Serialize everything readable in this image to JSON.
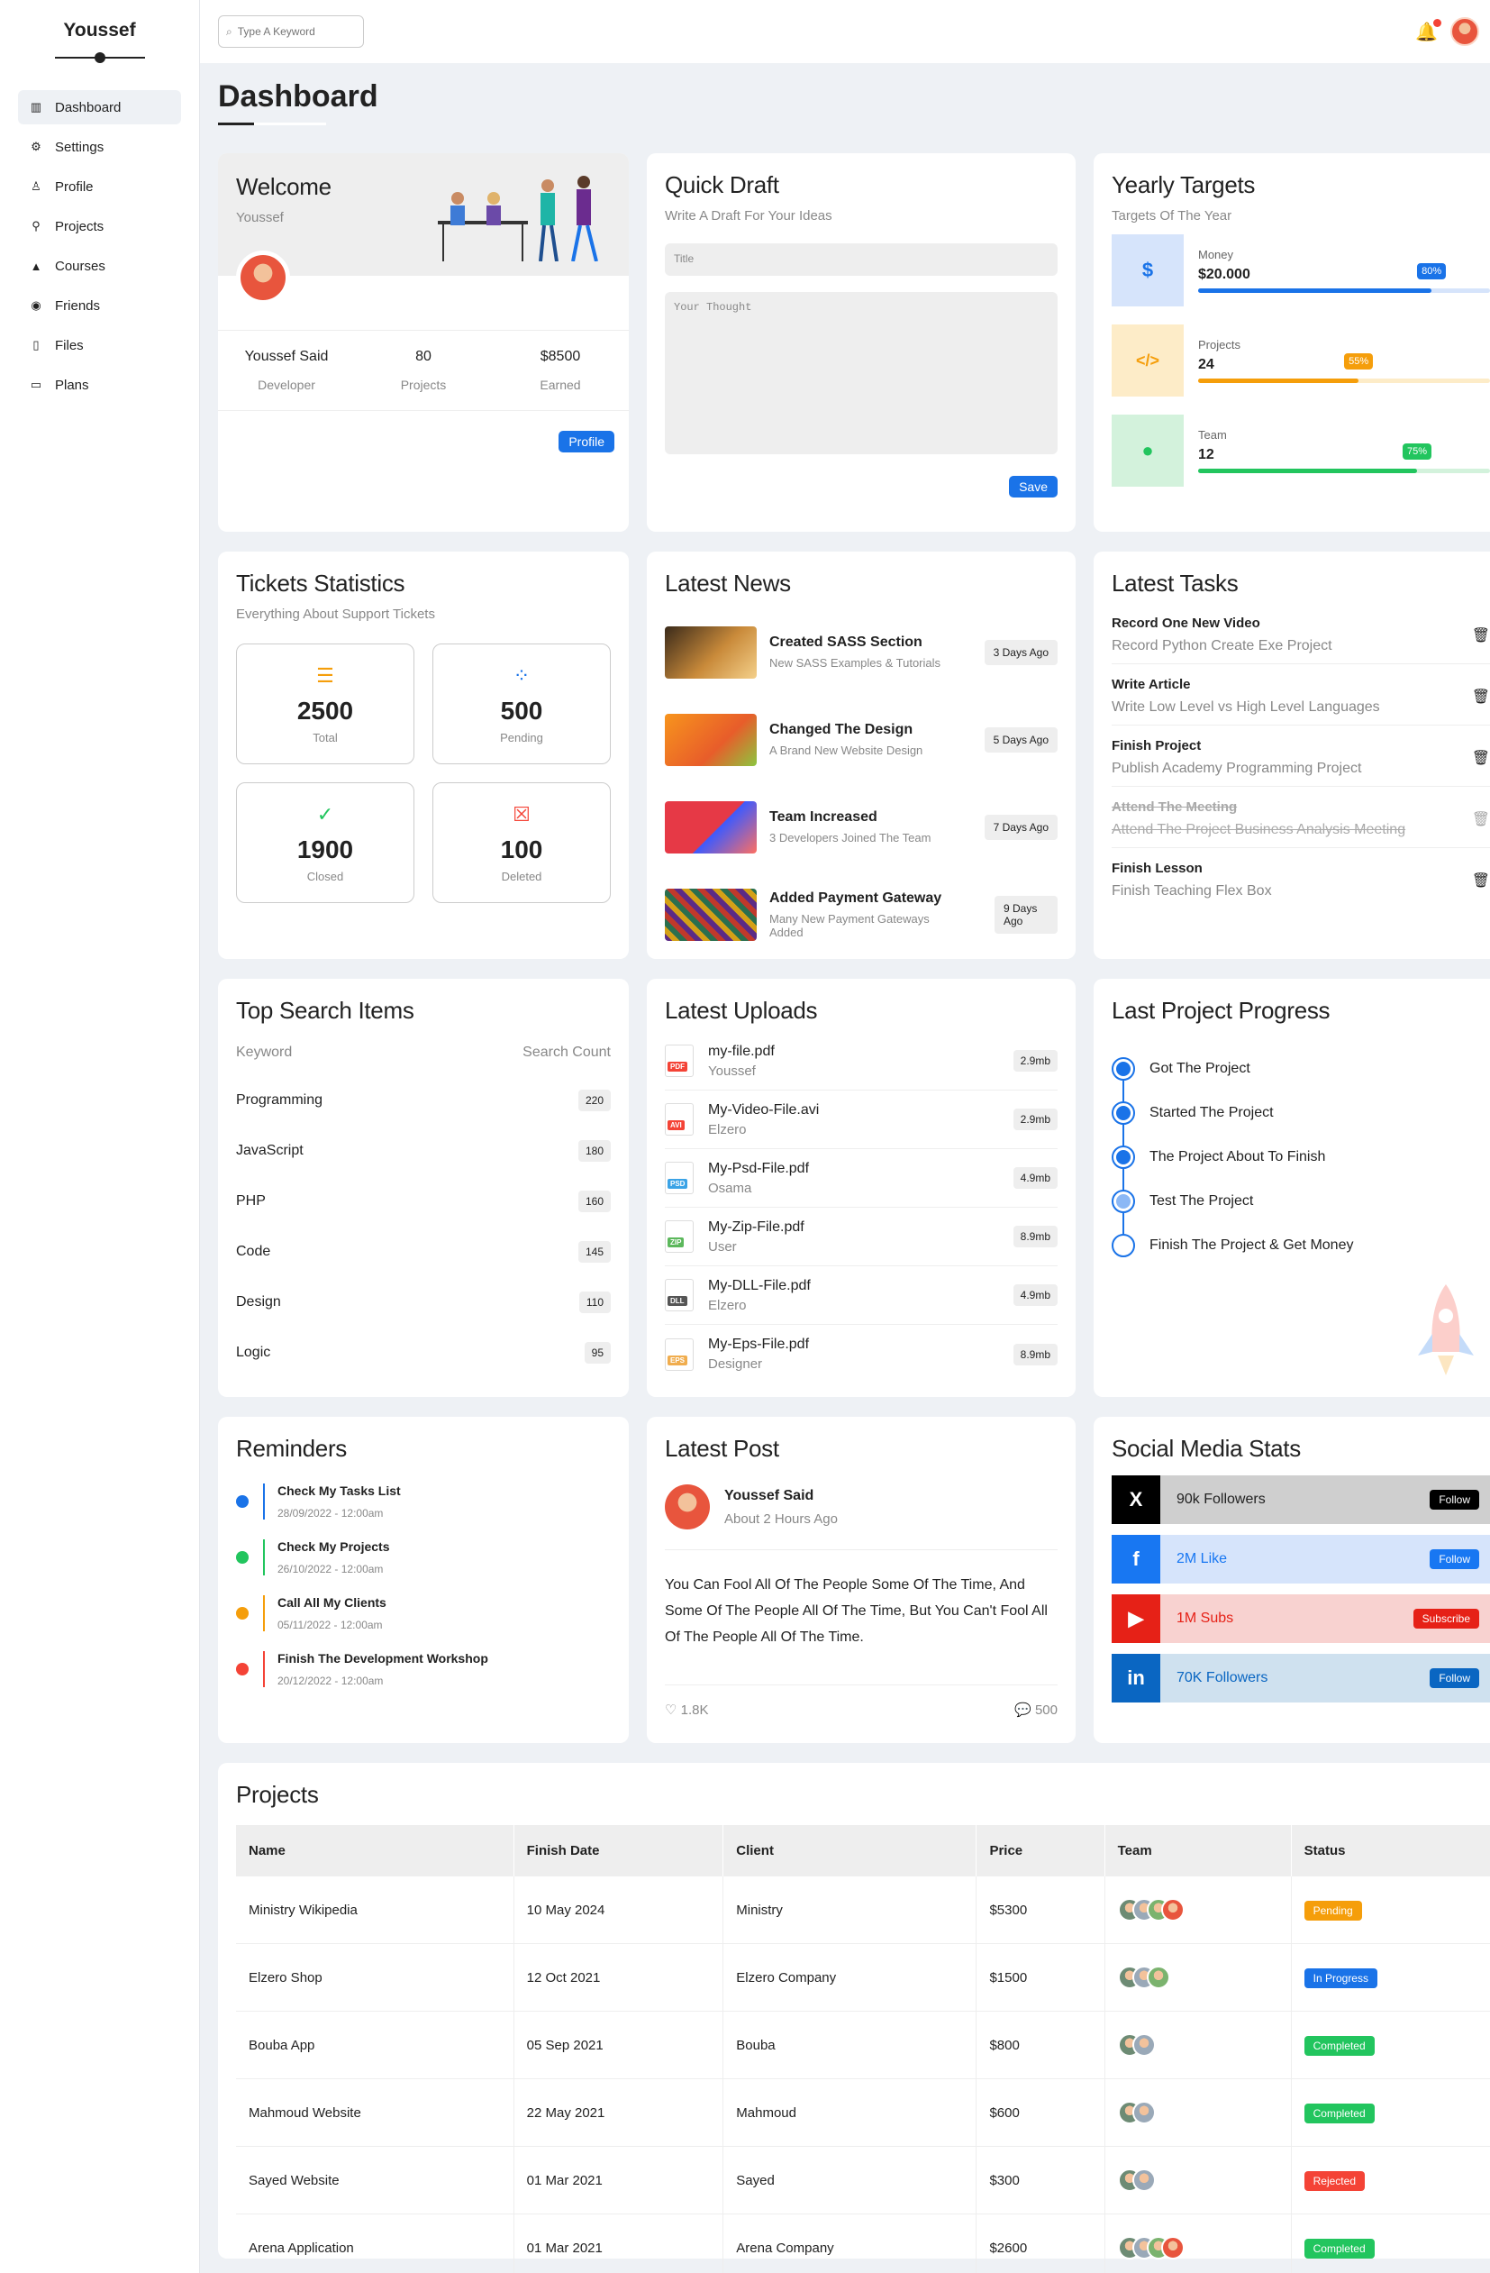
{
  "sidebar": {
    "brand": "Youssef",
    "items": [
      {
        "label": "Dashboard",
        "icon": "chart-icon"
      },
      {
        "label": "Settings",
        "icon": "gear-icon"
      },
      {
        "label": "Profile",
        "icon": "user-icon"
      },
      {
        "label": "Projects",
        "icon": "projects-icon"
      },
      {
        "label": "Courses",
        "icon": "graduation-cap-icon"
      },
      {
        "label": "Friends",
        "icon": "friends-icon"
      },
      {
        "label": "Files",
        "icon": "file-icon"
      },
      {
        "label": "Plans",
        "icon": "credit-card-icon"
      }
    ]
  },
  "header": {
    "search_placeholder": "Type A Keyword"
  },
  "page_title": "Dashboard",
  "welcome": {
    "title": "Welcome",
    "name": "Youssef",
    "stats": [
      {
        "value": "Youssef Said",
        "label": "Developer"
      },
      {
        "value": "80",
        "label": "Projects"
      },
      {
        "value": "$8500",
        "label": "Earned"
      }
    ],
    "button": "Profile"
  },
  "quick_draft": {
    "title": "Quick Draft",
    "subtitle": "Write A Draft For Your Ideas",
    "title_placeholder": "Title",
    "thought_placeholder": "Your Thought",
    "button": "Save"
  },
  "targets": {
    "title": "Yearly Targets",
    "subtitle": "Targets Of The Year",
    "items": [
      {
        "label": "Money",
        "value": "$20.000",
        "progress": 0.8,
        "pct_label": "80%",
        "color": "#1a73e8",
        "bg": "#d6e4fb",
        "icon": "$"
      },
      {
        "label": "Projects",
        "value": "24",
        "progress": 0.55,
        "pct_label": "55%",
        "color": "#f59e0b",
        "bg": "#fdecc8",
        "icon": "</>"
      },
      {
        "label": "Team",
        "value": "12",
        "progress": 0.75,
        "pct_label": "75%",
        "color": "#22c55e",
        "bg": "#d3f2dc",
        "icon": "person"
      }
    ]
  },
  "tickets": {
    "title": "Tickets Statistics",
    "subtitle": "Everything About Support Tickets",
    "items": [
      {
        "value": "2500",
        "label": "Total",
        "color": "#f59e0b"
      },
      {
        "value": "500",
        "label": "Pending",
        "color": "#1a73e8"
      },
      {
        "value": "1900",
        "label": "Closed",
        "color": "#22c55e"
      },
      {
        "value": "100",
        "label": "Deleted",
        "color": "#f44336"
      }
    ]
  },
  "news": {
    "title": "Latest News",
    "items": [
      {
        "title": "Created SASS Section",
        "desc": "New SASS Examples & Tutorials",
        "time": "3 Days Ago"
      },
      {
        "title": "Changed The Design",
        "desc": "A Brand New Website Design",
        "time": "5 Days Ago"
      },
      {
        "title": "Team Increased",
        "desc": "3 Developers Joined The Team",
        "time": "7 Days Ago"
      },
      {
        "title": "Added Payment Gateway",
        "desc": "Many New Payment Gateways Added",
        "time": "9 Days Ago"
      }
    ]
  },
  "tasks": {
    "title": "Latest Tasks",
    "items": [
      {
        "title": "Record One New Video",
        "desc": "Record Python Create Exe Project",
        "done": false
      },
      {
        "title": "Write Article",
        "desc": "Write Low Level vs High Level Languages",
        "done": false
      },
      {
        "title": "Finish Project",
        "desc": "Publish Academy Programming Project",
        "done": false
      },
      {
        "title": "Attend The Meeting",
        "desc": "Attend The Project Business Analysis Meeting",
        "done": true
      },
      {
        "title": "Finish Lesson",
        "desc": "Finish Teaching Flex Box",
        "done": false
      }
    ]
  },
  "search_items": {
    "title": "Top Search Items",
    "col_keyword": "Keyword",
    "col_count": "Search Count",
    "rows": [
      {
        "keyword": "Programming",
        "count": "220"
      },
      {
        "keyword": "JavaScript",
        "count": "180"
      },
      {
        "keyword": "PHP",
        "count": "160"
      },
      {
        "keyword": "Code",
        "count": "145"
      },
      {
        "keyword": "Design",
        "count": "110"
      },
      {
        "keyword": "Logic",
        "count": "95"
      }
    ]
  },
  "uploads": {
    "title": "Latest Uploads",
    "items": [
      {
        "name": "my-file.pdf",
        "user": "Youssef",
        "size": "2.9mb",
        "ext": "PDF",
        "color": "#f44336"
      },
      {
        "name": "My-Video-File.avi",
        "user": "Elzero",
        "size": "2.9mb",
        "ext": "AVI",
        "color": "#f44336"
      },
      {
        "name": "My-Psd-File.pdf",
        "user": "Osama",
        "size": "4.9mb",
        "ext": "PSD",
        "color": "#3ba3e6"
      },
      {
        "name": "My-Zip-File.pdf",
        "user": "User",
        "size": "8.9mb",
        "ext": "ZIP",
        "color": "#5cb85c"
      },
      {
        "name": "My-DLL-File.pdf",
        "user": "Elzero",
        "size": "4.9mb",
        "ext": "DLL",
        "color": "#555"
      },
      {
        "name": "My-Eps-File.pdf",
        "user": "Designer",
        "size": "8.9mb",
        "ext": "EPS",
        "color": "#f0ad4e"
      }
    ]
  },
  "project_progress": {
    "title": "Last Project Progress",
    "steps": [
      {
        "label": "Got The Project",
        "state": "done"
      },
      {
        "label": "Started The Project",
        "state": "done"
      },
      {
        "label": "The Project About To Finish",
        "state": "done"
      },
      {
        "label": "Test The Project",
        "state": "current"
      },
      {
        "label": "Finish The Project & Get Money",
        "state": "todo"
      }
    ]
  },
  "reminders": {
    "title": "Reminders",
    "items": [
      {
        "title": "Check My Tasks List",
        "date": "28/09/2022 - 12:00am",
        "color": "#1a73e8"
      },
      {
        "title": "Check My Projects",
        "date": "26/10/2022 - 12:00am",
        "color": "#22c55e"
      },
      {
        "title": "Call All My Clients",
        "date": "05/11/2022 - 12:00am",
        "color": "#f59e0b"
      },
      {
        "title": "Finish The Development Workshop",
        "date": "20/12/2022 - 12:00am",
        "color": "#f44336"
      }
    ]
  },
  "post": {
    "title": "Latest Post",
    "author": "Youssef Said",
    "time": "About 2 Hours Ago",
    "body": "You Can Fool All Of The People Some Of The Time, And Some Of The People All Of The Time, But You Can't Fool All Of The People All Of The Time.",
    "likes": "1.8K",
    "comments": "500"
  },
  "social": {
    "title": "Social Media Stats",
    "items": [
      {
        "text": "90k Followers",
        "button": "Follow",
        "icon": "X",
        "icon_bg": "#000",
        "bg": "#cfcfcf",
        "btn_bg": "#000",
        "fg": "#222"
      },
      {
        "text": "2M Like",
        "button": "Follow",
        "icon": "f",
        "icon_bg": "#1877f2",
        "bg": "#d6e4fb",
        "btn_bg": "#1877f2",
        "fg": "#1877f2"
      },
      {
        "text": "1M Subs",
        "button": "Subscribe",
        "icon": "▶",
        "icon_bg": "#e62117",
        "bg": "#f8d2d0",
        "btn_bg": "#e62117",
        "fg": "#e62117"
      },
      {
        "text": "70K Followers",
        "button": "Follow",
        "icon": "in",
        "icon_bg": "#0a66c2",
        "bg": "#cfe1ef",
        "btn_bg": "#0a66c2",
        "fg": "#0a66c2"
      }
    ]
  },
  "projects": {
    "title": "Projects",
    "columns": [
      "Name",
      "Finish Date",
      "Client",
      "Price",
      "Team",
      "Status"
    ],
    "rows": [
      {
        "name": "Ministry Wikipedia",
        "date": "10 May 2024",
        "client": "Ministry",
        "price": "$5300",
        "team": 4,
        "status": "Pending",
        "status_color": "#f59e0b"
      },
      {
        "name": "Elzero Shop",
        "date": "12 Oct 2021",
        "client": "Elzero Company",
        "price": "$1500",
        "team": 3,
        "status": "In Progress",
        "status_color": "#1a73e8"
      },
      {
        "name": "Bouba App",
        "date": "05 Sep 2021",
        "client": "Bouba",
        "price": "$800",
        "team": 2,
        "status": "Completed",
        "status_color": "#22c55e"
      },
      {
        "name": "Mahmoud Website",
        "date": "22 May 2021",
        "client": "Mahmoud",
        "price": "$600",
        "team": 2,
        "status": "Completed",
        "status_color": "#22c55e"
      },
      {
        "name": "Sayed Website",
        "date": "01 Mar 2021",
        "client": "Sayed",
        "price": "$300",
        "team": 2,
        "status": "Rejected",
        "status_color": "#f44336"
      },
      {
        "name": "Arena Application",
        "date": "01 Mar 2021",
        "client": "Arena Company",
        "price": "$2600",
        "team": 4,
        "status": "Completed",
        "status_color": "#22c55e"
      }
    ]
  }
}
